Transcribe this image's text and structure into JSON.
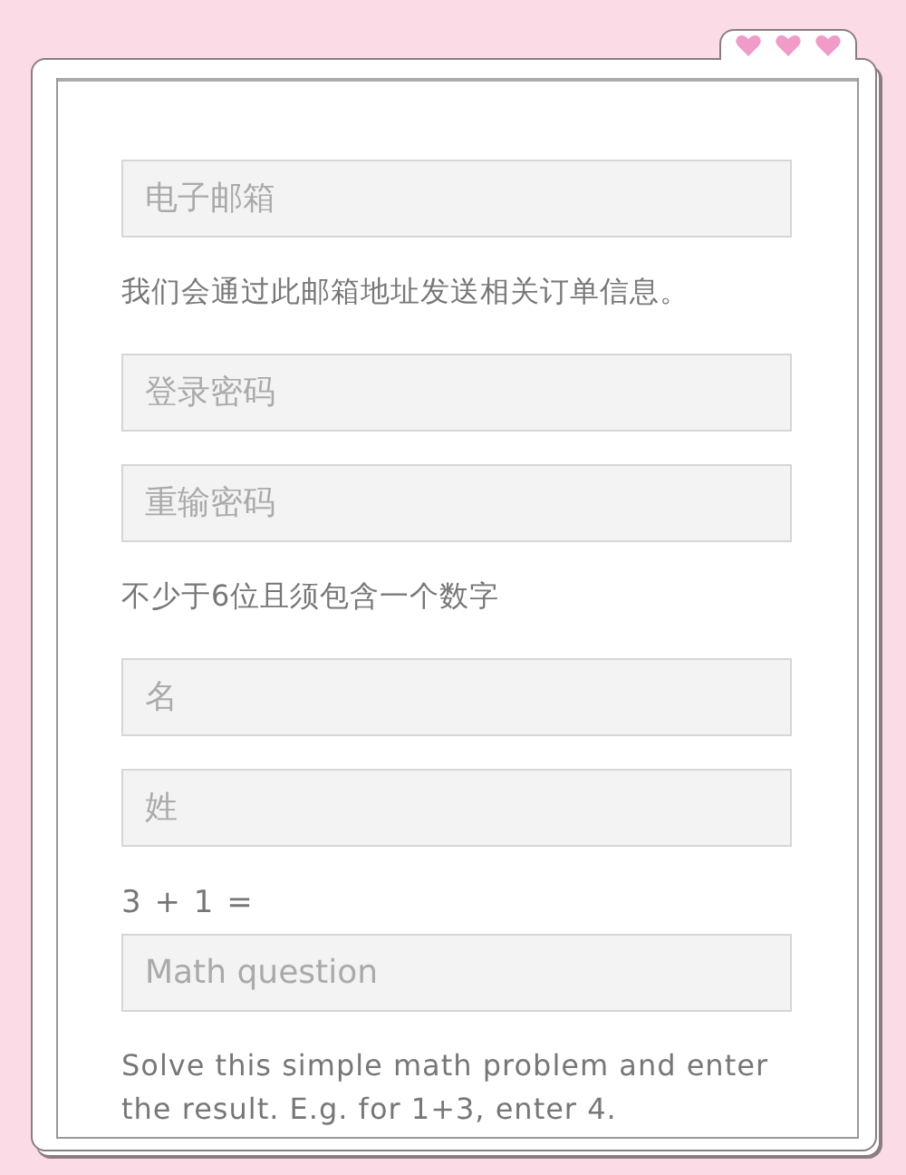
{
  "form": {
    "items": [
      {
        "kind": "field",
        "placeholder": "电子邮箱"
      },
      {
        "kind": "note",
        "text": "我们会通过此邮箱地址发送相关订单信息。"
      },
      {
        "kind": "field",
        "placeholder": "登录密码"
      },
      {
        "kind": "field",
        "placeholder": "重输密码"
      },
      {
        "kind": "note",
        "text": "不少于6位且须包含一个数字"
      },
      {
        "kind": "field",
        "placeholder": "名"
      },
      {
        "kind": "field",
        "placeholder": "姓"
      },
      {
        "kind": "label",
        "text": "3 + 1 ="
      },
      {
        "kind": "field",
        "placeholder": "Math question"
      },
      {
        "kind": "note",
        "text": "Solve this simple math problem and enter the result. E.g. for 1+3, enter 4."
      }
    ]
  }
}
